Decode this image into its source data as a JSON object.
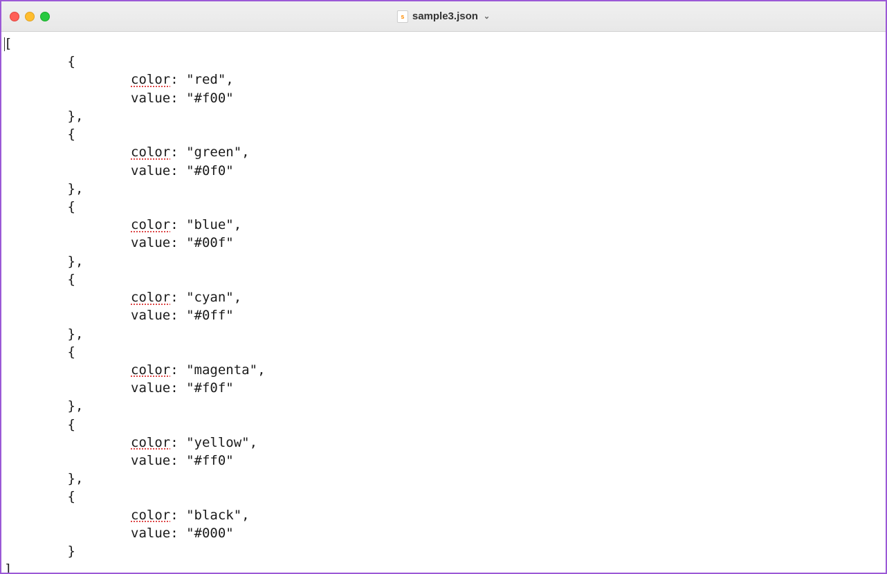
{
  "window": {
    "filename": "sample3.json",
    "file_icon_letter": "s"
  },
  "code": {
    "open_bracket": "[",
    "close_bracket": "]",
    "obj_open": "{",
    "obj_close": "}",
    "obj_close_comma": "},",
    "key_color_label": "color",
    "key_value_label": "value",
    "colon_space": ": ",
    "quote": "\"",
    "comma": ",",
    "entries": [
      {
        "color": "red",
        "value": "#f00"
      },
      {
        "color": "green",
        "value": "#0f0"
      },
      {
        "color": "blue",
        "value": "#00f"
      },
      {
        "color": "cyan",
        "value": "#0ff"
      },
      {
        "color": "magenta",
        "value": "#f0f"
      },
      {
        "color": "yellow",
        "value": "#ff0"
      },
      {
        "color": "black",
        "value": "#000"
      }
    ]
  }
}
